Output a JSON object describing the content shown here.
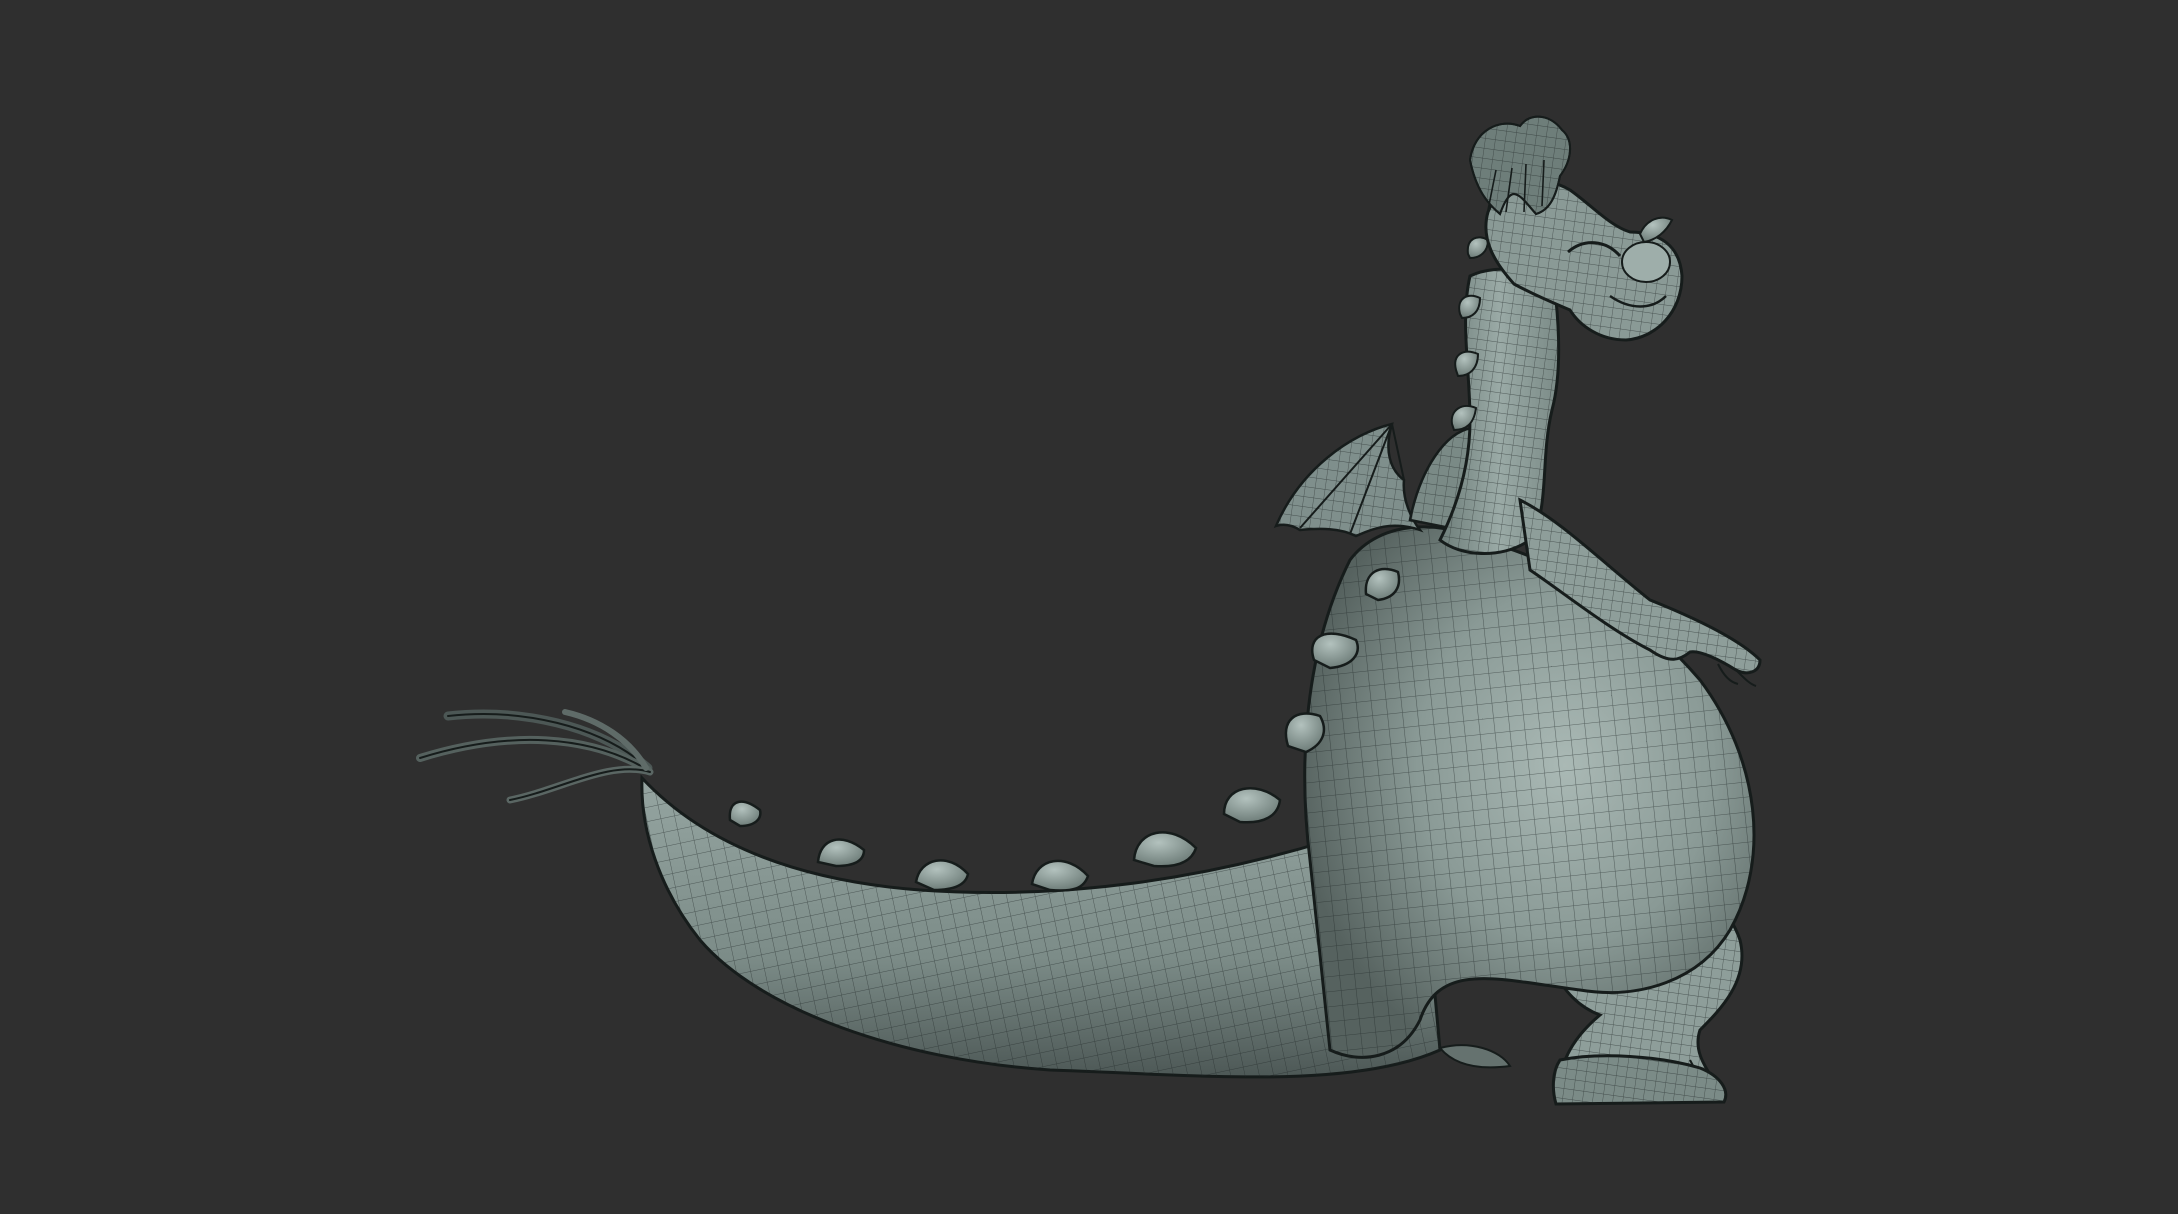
{
  "scene": {
    "subject": "dragon-sculpt",
    "render_style": "clay wireframe",
    "colors": {
      "background": "#2f2f2f",
      "clay": "#7f8f8c",
      "clay_light": "#a3b3af",
      "clay_shadow": "#4c5755",
      "wire": "#1f2726",
      "outline": "#161c1b"
    }
  }
}
